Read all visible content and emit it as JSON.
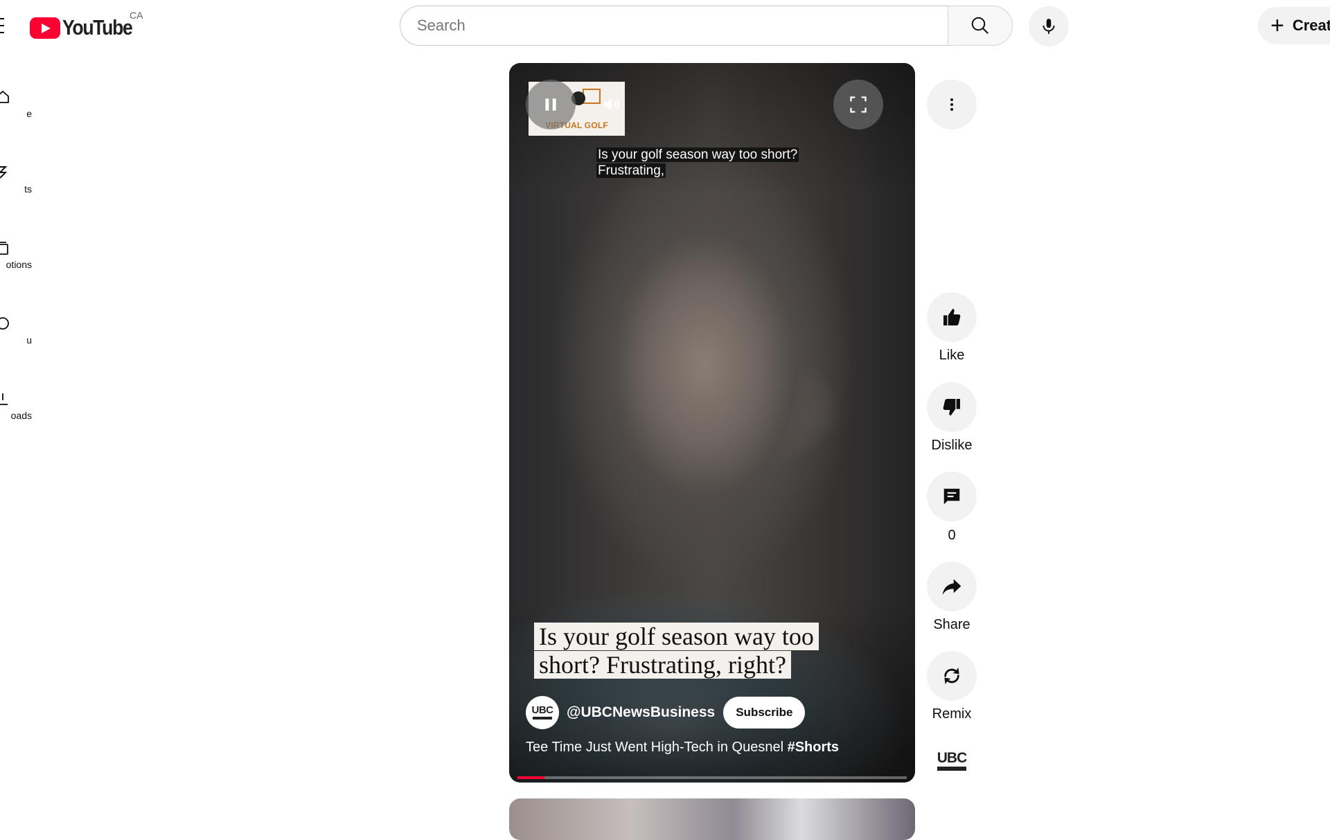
{
  "header": {
    "logo_text": "YouTube",
    "country_code": "CA",
    "search_placeholder": "Search",
    "create_label": "Create"
  },
  "sidebar": {
    "items": [
      {
        "label": "Home",
        "icon": "home-icon"
      },
      {
        "label": "Shorts",
        "icon": "shorts-icon"
      },
      {
        "label": "Subscriptions",
        "icon": "subscriptions-icon"
      },
      {
        "label": "You",
        "icon": "you-icon"
      },
      {
        "label": "Downloads",
        "icon": "downloads-icon"
      }
    ],
    "visible_fragments": [
      "e",
      "ts",
      "otions",
      "u",
      "oads"
    ]
  },
  "video": {
    "brand_badge_text": "VIRTUAL GOLF",
    "caption_small_line1": "Is your golf season way too short?",
    "caption_small_line2": "Frustrating,",
    "caption_big_line1": "Is your golf season way too",
    "caption_big_line2": "short? Frustrating, right?",
    "channel_avatar_text": "UBC",
    "channel_name": "@UBCNewsBusiness",
    "subscribe_label": "Subscribe",
    "title_text": "Tee Time Just Went High-Tech in Quesnel ",
    "title_hashtag": "#Shorts",
    "progress_fraction": 0.07,
    "accent_color": "#ff0033"
  },
  "actions": {
    "like_label": "Like",
    "dislike_label": "Dislike",
    "comments_count": "0",
    "share_label": "Share",
    "remix_label": "Remix",
    "channel_logo_text": "UBC"
  }
}
